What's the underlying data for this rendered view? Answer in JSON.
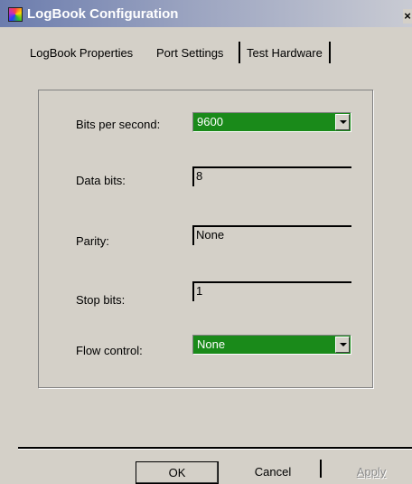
{
  "window": {
    "title": "LogBook Configuration",
    "close_label": "×"
  },
  "tabs": [
    {
      "label": "LogBook Properties"
    },
    {
      "label": "Port Settings"
    },
    {
      "label": "Test Hardware"
    }
  ],
  "port_settings": {
    "bits_per_second": {
      "label": "Bits per second:",
      "value": "9600"
    },
    "data_bits": {
      "label": "Data bits:",
      "value": "8"
    },
    "parity": {
      "label": "Parity:",
      "value": "None"
    },
    "stop_bits": {
      "label": "Stop bits:",
      "value": "1"
    },
    "flow_control": {
      "label": "Flow control:",
      "value": "None"
    }
  },
  "buttons": {
    "ok": "OK",
    "cancel": "Cancel",
    "apply": "Apply"
  },
  "colors": {
    "titlebar_start": "#6b7cad",
    "selected_combo": "#1a8a1a",
    "dialog_background": "#d4d0c8"
  }
}
